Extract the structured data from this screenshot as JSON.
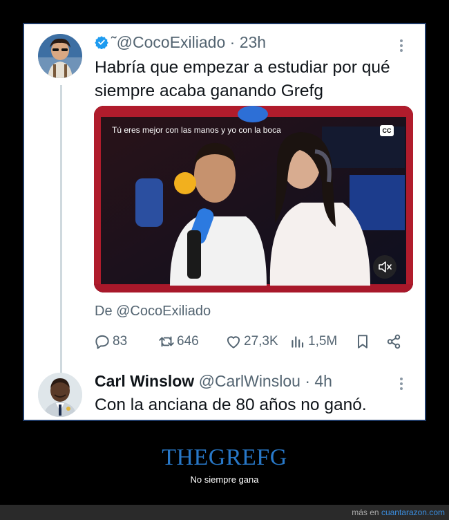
{
  "tweet": {
    "handle": "@CocoExiliado",
    "prefix": "˜",
    "time": "· 23h",
    "text_line1": "Habría que empezar a estudiar por qué",
    "text_line2": "siempre acaba ganando Grefg",
    "media": {
      "caption": "Tú eres mejor con las manos y yo con la boca",
      "cc_label": "CC"
    },
    "from_label": "De @CocoExiliado",
    "stats": {
      "replies": "83",
      "retweets": "646",
      "likes": "27,3K",
      "views": "1,5M"
    }
  },
  "reply": {
    "name": "Carl Winslow",
    "handle": "@CarlWinslou",
    "time": "· 4h",
    "text": "Con la anciana de 80 años no ganó."
  },
  "footer": {
    "title": "THEGREFG",
    "subtitle": "No siempre gana",
    "credit_prefix": "más en",
    "credit_site": "cuantarazon.com"
  },
  "colors": {
    "accent": "#1d9bf0",
    "footer_title": "#2878c8",
    "frame_border": "#1f3a66"
  }
}
